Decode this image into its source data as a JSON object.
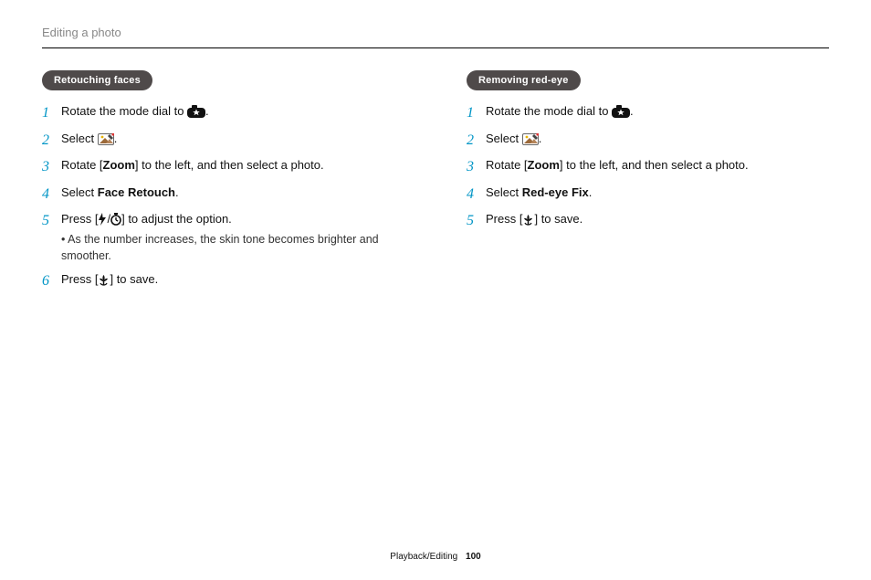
{
  "header": {
    "title": "Editing a photo"
  },
  "left": {
    "pill": "Retouching faces",
    "steps": [
      {
        "num": "1",
        "parts": [
          "Rotate the mode dial to ",
          {
            "icon": "camera-star"
          },
          "."
        ]
      },
      {
        "num": "2",
        "parts": [
          "Select ",
          {
            "icon": "edit-image"
          },
          "."
        ]
      },
      {
        "num": "3",
        "parts": [
          "Rotate [",
          {
            "bold": "Zoom"
          },
          "] to the left, and then select a photo."
        ]
      },
      {
        "num": "4",
        "parts": [
          "Select ",
          {
            "bold": "Face Retouch"
          },
          "."
        ]
      },
      {
        "num": "5",
        "parts": [
          "Press [",
          {
            "icon": "flash"
          },
          "/",
          {
            "icon": "timer"
          },
          "] to adjust the option."
        ],
        "sub": "As the number increases, the skin tone becomes brighter and smoother."
      },
      {
        "num": "6",
        "parts": [
          "Press [",
          {
            "icon": "macro"
          },
          "] to save."
        ]
      }
    ]
  },
  "right": {
    "pill": "Removing red-eye",
    "steps": [
      {
        "num": "1",
        "parts": [
          "Rotate the mode dial to ",
          {
            "icon": "camera-star"
          },
          "."
        ]
      },
      {
        "num": "2",
        "parts": [
          "Select ",
          {
            "icon": "edit-image"
          },
          "."
        ]
      },
      {
        "num": "3",
        "parts": [
          "Rotate [",
          {
            "bold": "Zoom"
          },
          "] to the left, and then select a photo."
        ]
      },
      {
        "num": "4",
        "parts": [
          "Select ",
          {
            "bold": "Red-eye Fix"
          },
          "."
        ]
      },
      {
        "num": "5",
        "parts": [
          "Press [",
          {
            "icon": "macro"
          },
          "] to save."
        ]
      }
    ]
  },
  "footer": {
    "section": "Playback/Editing",
    "page": "100"
  }
}
